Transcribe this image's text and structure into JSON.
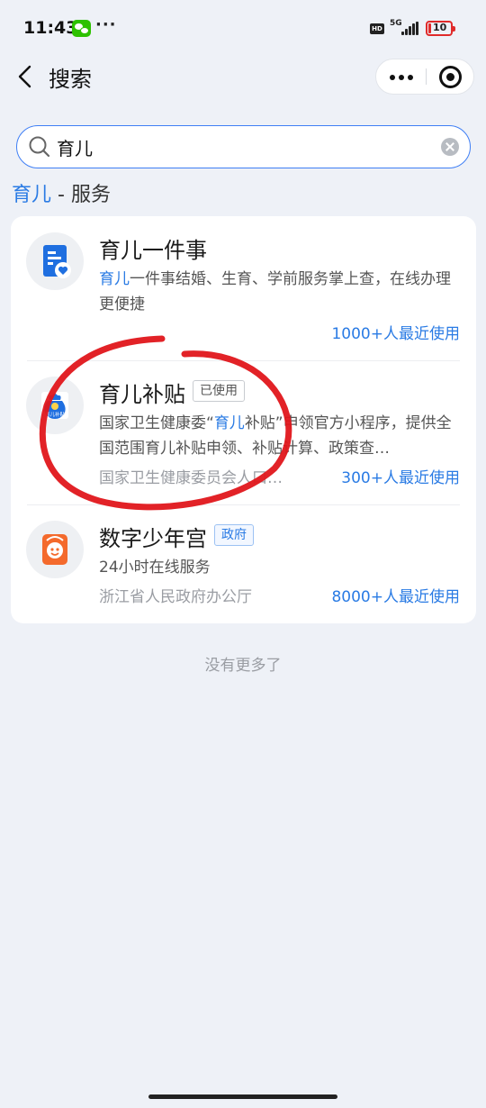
{
  "status_bar": {
    "time": "11:43",
    "more": "···",
    "hd_badge": "HD",
    "network": "5G",
    "battery": "10"
  },
  "header": {
    "title": "搜索"
  },
  "search": {
    "query": "育儿"
  },
  "section": {
    "highlight": "育儿",
    "suffix": " - 服务"
  },
  "results": [
    {
      "title": "育儿一件事",
      "desc_hl": "育儿",
      "desc_rest": "一件事结婚、生育、学前服务掌上查，在线办理更便捷",
      "usage": "1000+人最近使用"
    },
    {
      "title": "育儿补贴",
      "tag": "已使用",
      "icon_text": "育儿补贴",
      "desc_pre": "国家卫生健康委“",
      "desc_hl": "育儿",
      "desc_rest": "补贴”申领官方小程序，提供全国范围育儿补贴申领、补贴计算、政策查…",
      "provider": "国家卫生健康委员会人口…",
      "usage": "300+人最近使用"
    },
    {
      "title": "数字少年宫",
      "tag": "政府",
      "desc": "24小时在线服务",
      "provider": "浙江省人民政府办公厅",
      "usage": "8000+人最近使用"
    }
  ],
  "footer": {
    "end_text": "没有更多了"
  },
  "colors": {
    "accent": "#2a7be4",
    "annotation": "#e0161b",
    "background": "#eef1f7"
  }
}
